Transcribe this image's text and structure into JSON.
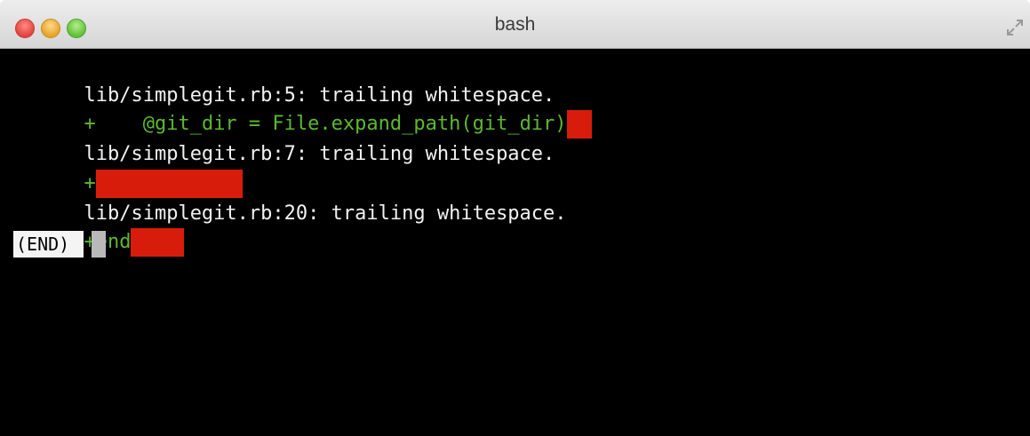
{
  "window": {
    "title": "bash",
    "controls": [
      "close",
      "minimize",
      "maximize"
    ],
    "resize_icon": "fullscreen-arrows-icon"
  },
  "terminal": {
    "lines": [
      {
        "text": "lib/simplegit.rb:5: trailing whitespace."
      },
      {
        "prefix": "+    ",
        "code": "@git_dir = File.expand_path(git_dir)"
      },
      {
        "text": "lib/simplegit.rb:7: trailing whitespace."
      },
      {
        "prefix": "+"
      },
      {
        "text": "lib/simplegit.rb:20: trailing whitespace."
      },
      {
        "prefix": "+end"
      }
    ],
    "pager_status": "(END)"
  },
  "colors": {
    "terminal_bg": "#000000",
    "text": "#f2f2f2",
    "added_line": "#5cb82f",
    "whitespace_highlight": "#d81c0c"
  }
}
